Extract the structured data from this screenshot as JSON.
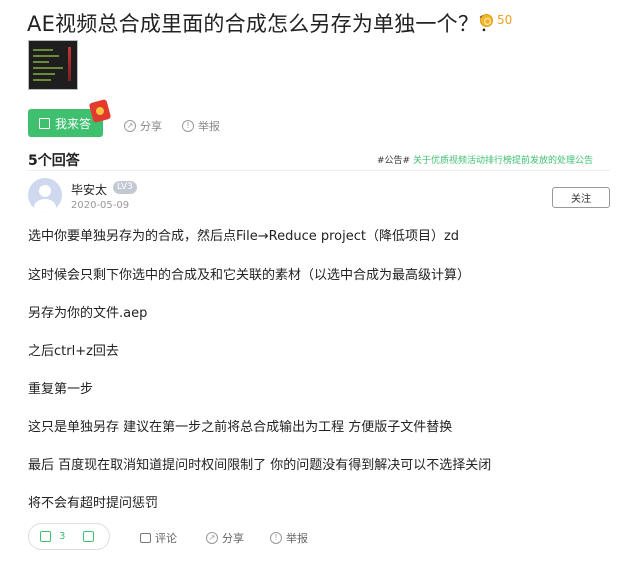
{
  "question": {
    "title": "AE视频总合成里面的合成怎么另存为单独一个？？",
    "reward": "50",
    "answer_button": "我来答",
    "share": "分享",
    "report": "举报"
  },
  "answers": {
    "count_label": "5个回答",
    "notice_tag": "#公告#",
    "notice_text": "关于优质视频活动排行榜提前发放的处理公告"
  },
  "answer": {
    "username": "毕安太",
    "level": "LV3",
    "date": "2020-05-09",
    "follow": "关注",
    "paragraphs": [
      "选中你要单独另存为的合成，然后点File→Reduce project（降低项目）zd",
      "这时候会只剩下你选中的合成及和它关联的素材（以选中合成为最高级计算）",
      "另存为你的文件.aep",
      "之后ctrl+z回去",
      "重复第一步",
      "这只是单独另存 建议在第一步之前将总合成输出为工程 方便版子文件替换",
      "最后 百度现在取消知道提问时权间限制了 你的问题没有得到解决可以不选择关闭",
      "将不会有超时提问惩罚"
    ],
    "likes": "3",
    "comment": "评论",
    "share": "分享",
    "report": "举报"
  },
  "colors": {
    "accent": "#3ec06f",
    "reward": "#f0a020"
  }
}
